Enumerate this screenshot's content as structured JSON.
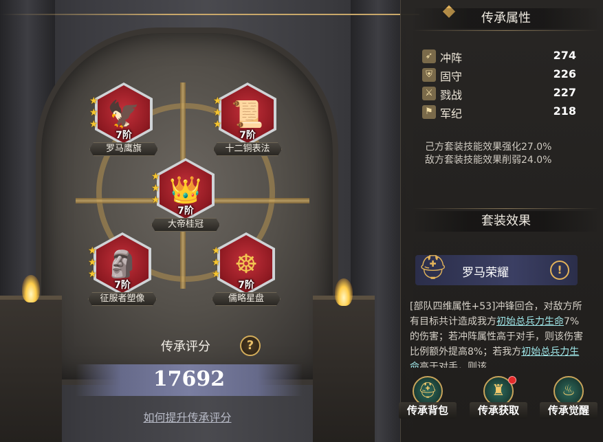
{
  "items": [
    {
      "name": "罗马鹰旗",
      "level": "7阶",
      "icon": "eagle-standard-icon",
      "glyph": "🦅"
    },
    {
      "name": "十二铜表法",
      "level": "7阶",
      "icon": "bronze-tablets-icon",
      "glyph": "📜"
    },
    {
      "name": "大帝桂冠",
      "level": "7阶",
      "icon": "laurel-crown-icon",
      "glyph": "👑"
    },
    {
      "name": "征服者塑像",
      "level": "7阶",
      "icon": "conqueror-statue-icon",
      "glyph": "🗿"
    },
    {
      "name": "儒略星盘",
      "level": "7阶",
      "icon": "astrolabe-icon",
      "glyph": "☸"
    }
  ],
  "star_glyph": "★",
  "score": {
    "title": "传承评分",
    "help": "?",
    "value": "17692",
    "link": "如何提升传承评分"
  },
  "panel": {
    "diamond": "◆",
    "attributes_title": "传承属性",
    "attributes": [
      {
        "name": "冲阵",
        "value": "274",
        "icon": "charge-icon",
        "glyph": "➶"
      },
      {
        "name": "固守",
        "value": "226",
        "icon": "shield-icon",
        "glyph": "⛨"
      },
      {
        "name": "戮战",
        "value": "227",
        "icon": "crossed-swords-icon",
        "glyph": "⚔"
      },
      {
        "name": "军纪",
        "value": "218",
        "icon": "banner-icon",
        "glyph": "⚑"
      }
    ],
    "effects": [
      "己方套装技能效果强化27.0%",
      "敌方套装技能效果削弱24.0%"
    ],
    "set_title": "套装效果",
    "set_name": "罗马荣耀",
    "set_warning": "!",
    "helmet_glyph": "⛑",
    "desc_part1": "[部队四维属性+53]冲锋回合，对敌方所有目标共计造成我方",
    "desc_hl1": "初始总兵力生命",
    "desc_part2": "7%的伤害；若冲阵属性高于对手，则该伤害比例额外提高8%；若我方",
    "desc_hl2": "初始总兵力生命",
    "desc_part3": "高于对手，则该"
  },
  "buttons": [
    {
      "label": "传承背包",
      "icon": "helmet-bag-icon",
      "glyph": "⛑"
    },
    {
      "label": "传承获取",
      "icon": "acquire-icon",
      "glyph": "♜",
      "badge": true
    },
    {
      "label": "传承觉醒",
      "icon": "awaken-flame-icon",
      "glyph": "♨"
    }
  ],
  "colors": {
    "accent_gold": "#d3ad5b",
    "item_red": "#8f1a22",
    "highlight_cyan": "#9fe6e8",
    "reddot": "#e22a2a"
  }
}
